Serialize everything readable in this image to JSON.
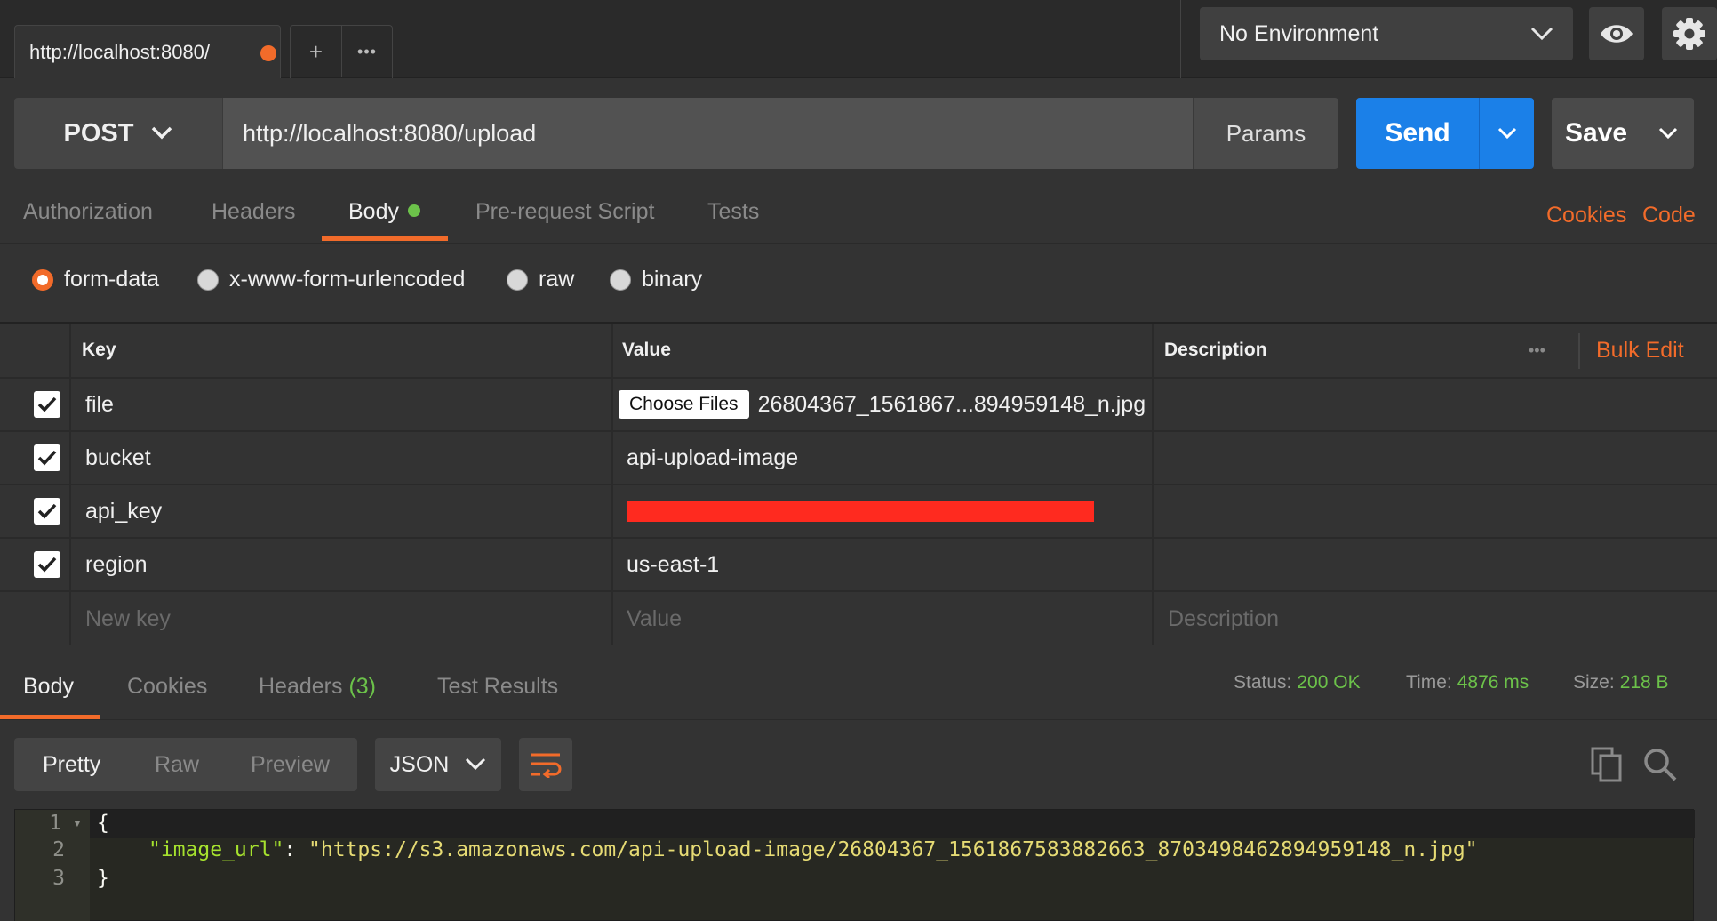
{
  "tab": {
    "title": "http://localhost:8080/",
    "new_tab": "+",
    "more": "•••"
  },
  "environment": {
    "selected": "No Environment"
  },
  "icons": {
    "eye": "eye-icon",
    "settings": "gear-icon"
  },
  "request": {
    "method": "POST",
    "url": "http://localhost:8080/upload",
    "params_label": "Params",
    "send_label": "Send",
    "save_label": "Save"
  },
  "request_tabs": {
    "authorization": "Authorization",
    "headers": "Headers",
    "body": "Body",
    "prerequest": "Pre-request Script",
    "tests": "Tests",
    "cookies": "Cookies",
    "code": "Code"
  },
  "body_types": {
    "form_data": "form-data",
    "urlencoded": "x-www-form-urlencoded",
    "raw": "raw",
    "binary": "binary",
    "selected": "form-data"
  },
  "table": {
    "headers": {
      "key": "Key",
      "value": "Value",
      "description": "Description",
      "more": "•••",
      "bulk_edit": "Bulk Edit"
    },
    "rows": [
      {
        "key": "file",
        "choose_label": "Choose Files",
        "value": "26804367_1561867...894959148_n.jpg",
        "checked": true
      },
      {
        "key": "bucket",
        "value": "api-upload-image",
        "checked": true
      },
      {
        "key": "api_key",
        "value": "",
        "redacted": true,
        "checked": true
      },
      {
        "key": "region",
        "value": "us-east-1",
        "checked": true
      }
    ],
    "placeholders": {
      "key": "New key",
      "value": "Value",
      "description": "Description"
    }
  },
  "response": {
    "tabs": {
      "body": "Body",
      "cookies": "Cookies",
      "headers": "Headers",
      "headers_count": "(3)",
      "tests": "Test Results"
    },
    "status_label": "Status:",
    "status": "200 OK",
    "time_label": "Time:",
    "time": "4876 ms",
    "size_label": "Size:",
    "size": "218 B",
    "views": {
      "pretty": "Pretty",
      "raw": "Raw",
      "preview": "Preview"
    },
    "format": "JSON",
    "code": {
      "line_numbers": [
        "1",
        "2",
        "3"
      ],
      "open": "{",
      "key": "\"image_url\"",
      "colon": ": ",
      "value": "\"https://s3.amazonaws.com/api-upload-image/26804367_1561867583882663_8703498462894959148_n.jpg\"",
      "close": "}"
    }
  },
  "colors": {
    "accent": "#f26b2a",
    "send": "#1b80e8",
    "success": "#6cc24a",
    "redaction": "#ff2a1f"
  }
}
